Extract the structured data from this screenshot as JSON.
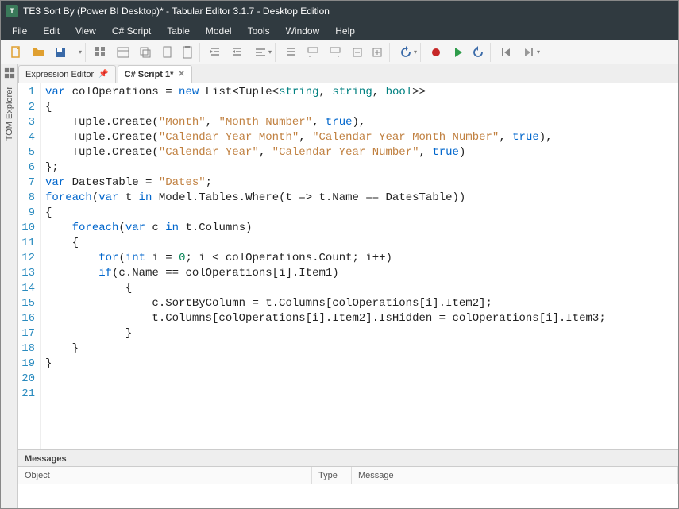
{
  "window": {
    "title": "TE3 Sort By (Power BI Desktop)* - Tabular Editor 3.1.7 - Desktop Edition",
    "logo_text": "T"
  },
  "menu": {
    "file": "File",
    "edit": "Edit",
    "view": "View",
    "csharp": "C# Script",
    "table": "Table",
    "model": "Model",
    "tools": "Tools",
    "window": "Window",
    "help": "Help"
  },
  "left_rail": {
    "label": "TOM Explorer"
  },
  "tabs": {
    "expression_editor": "Expression Editor",
    "csharp_script": "C# Script 1*"
  },
  "code": {
    "lines": 21,
    "l1a": "var",
    "l1b": " colOperations = ",
    "l1c": "new",
    "l1d": " List<Tuple<",
    "l1e": "string",
    "l1f": ", ",
    "l1g": "string",
    "l1h": ", ",
    "l1i": "bool",
    "l1j": ">>",
    "l2": "{",
    "l3a": "    Tuple.Create(",
    "l3b": "\"Month\"",
    "l3c": ", ",
    "l3d": "\"Month Number\"",
    "l3e": ", ",
    "l3f": "true",
    "l3g": "),",
    "l4a": "    Tuple.Create(",
    "l4b": "\"Calendar Year Month\"",
    "l4c": ", ",
    "l4d": "\"Calendar Year Month Number\"",
    "l4e": ", ",
    "l4f": "true",
    "l4g": "),",
    "l5a": "    Tuple.Create(",
    "l5b": "\"Calendar Year\"",
    "l5c": ", ",
    "l5d": "\"Calendar Year Number\"",
    "l5e": ", ",
    "l5f": "true",
    "l5g": ")",
    "l6": "};",
    "l7": "",
    "l8a": "var",
    "l8b": " DatesTable = ",
    "l8c": "\"Dates\"",
    "l8d": ";",
    "l9": "",
    "l10a": "foreach",
    "l10b": "(",
    "l10c": "var",
    "l10d": " t ",
    "l10e": "in",
    "l10f": " Model.Tables.Where(t => t.Name == DatesTable))",
    "l11": "{",
    "l12a": "    ",
    "l12b": "foreach",
    "l12c": "(",
    "l12d": "var",
    "l12e": " c ",
    "l12f": "in",
    "l12g": " t.Columns)",
    "l13": "    {",
    "l14a": "        ",
    "l14b": "for",
    "l14c": "(",
    "l14d": "int",
    "l14e": " i = ",
    "l14f": "0",
    "l14g": "; i < colOperations.Count; i++)",
    "l15a": "        ",
    "l15b": "if",
    "l15c": "(c.Name == colOperations[i].Item1)",
    "l16": "            {",
    "l17": "                c.SortByColumn = t.Columns[colOperations[i].Item2];",
    "l18": "                t.Columns[colOperations[i].Item2].IsHidden = colOperations[i].Item3;",
    "l19": "            }",
    "l20": "    }",
    "l21": "}"
  },
  "messages": {
    "title": "Messages",
    "col_object": "Object",
    "col_type": "Type",
    "col_message": "Message"
  }
}
